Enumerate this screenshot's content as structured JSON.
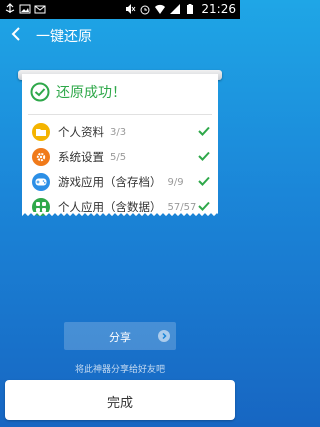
{
  "status_bar": {
    "time": "21:26",
    "battery": "100%"
  },
  "header": {
    "title": "一键还原"
  },
  "receipt": {
    "success_text": "还原成功！",
    "items": [
      {
        "icon": "folder-icon",
        "color": "#f4b400",
        "label": "个人资料",
        "count": "3/3"
      },
      {
        "icon": "gear-icon",
        "color": "#f07a1a",
        "label": "系统设置",
        "count": "5/5"
      },
      {
        "icon": "gamepad-icon",
        "color": "#2c8fe6",
        "label": "游戏应用（含存档）",
        "count": "9/9"
      },
      {
        "icon": "apps-grid-icon",
        "color": "#2fa84a",
        "label": "个人应用（含数据）",
        "count": "57/57"
      }
    ]
  },
  "share": {
    "label": "分享",
    "hint": "将此神器分享给好友吧"
  },
  "done": {
    "label": "完成"
  },
  "colors": {
    "accent_green": "#2fa84a",
    "background_blue": "#1b86d8"
  }
}
